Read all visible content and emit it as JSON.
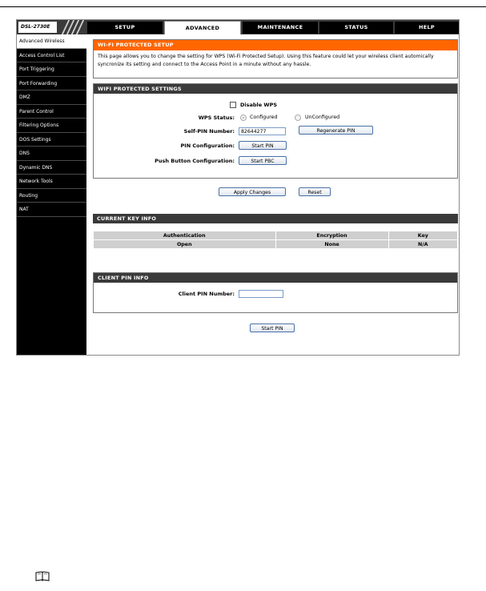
{
  "header": {
    "brand": "DSL-2730E",
    "tabs": [
      {
        "label": "SETUP",
        "active": false
      },
      {
        "label": "ADVANCED",
        "active": true
      },
      {
        "label": "MAINTENANCE",
        "active": false
      },
      {
        "label": "STATUS",
        "active": false
      },
      {
        "label": "HELP",
        "active": false
      }
    ]
  },
  "sidebar": {
    "items": [
      {
        "label": "Advanced Wireless",
        "active": true
      },
      {
        "label": "Access Control List",
        "active": false
      },
      {
        "label": "Port Triggering",
        "active": false
      },
      {
        "label": "Port Forwarding",
        "active": false
      },
      {
        "label": "DMZ",
        "active": false
      },
      {
        "label": "Parent Control",
        "active": false
      },
      {
        "label": "Filtering Options",
        "active": false
      },
      {
        "label": "DOS Settings",
        "active": false
      },
      {
        "label": "DNS",
        "active": false
      },
      {
        "label": "Dynamic DNS",
        "active": false
      },
      {
        "label": "Network Tools",
        "active": false
      },
      {
        "label": "Routing",
        "active": false
      },
      {
        "label": "NAT",
        "active": false
      }
    ]
  },
  "wps_intro": {
    "title": "WI-FI PROTECTED SETUP",
    "description": "This page allows you to change the setting for WPS (Wi-Fi Protected Setup). Using this feature could let your wireless client automically syncronize its setting and connect to the Access Point in a minute without any hassle."
  },
  "wps_settings": {
    "title": "WIFI PROTECTED SETTINGS",
    "disable_wps_label": "Disable WPS",
    "disable_wps_checked": false,
    "wps_status_label": "WPS Status:",
    "status_configured": "Configured",
    "status_unconfigured": "UnConfigured",
    "status_selected": "Configured",
    "self_pin_label": "Self-PIN Number:",
    "self_pin_value": "82644277",
    "regenerate_pin_button": "Regenerate PIN",
    "pin_config_label": "PIN Configuration:",
    "start_pin_button": "Start PIN",
    "push_button_label": "Push Button Configuration:",
    "start_pbc_button": "Start PBC"
  },
  "actions": {
    "apply_button": "Apply Changes",
    "reset_button": "Reset"
  },
  "key_info": {
    "title": "CURRENT KEY INFO",
    "headers": [
      "Authentication",
      "Encryption",
      "Key"
    ],
    "row": [
      "Open",
      "None",
      "N/A"
    ]
  },
  "client_pin": {
    "title": "CLIENT PIN INFO",
    "label": "Client PIN Number:",
    "value": "",
    "start_pin_button": "Start PIN"
  },
  "colors": {
    "accent_orange": "#ff6600",
    "header_dark": "#3a3a3a",
    "sidebar_black": "#000000"
  },
  "icons": {
    "note": "book-icon"
  }
}
